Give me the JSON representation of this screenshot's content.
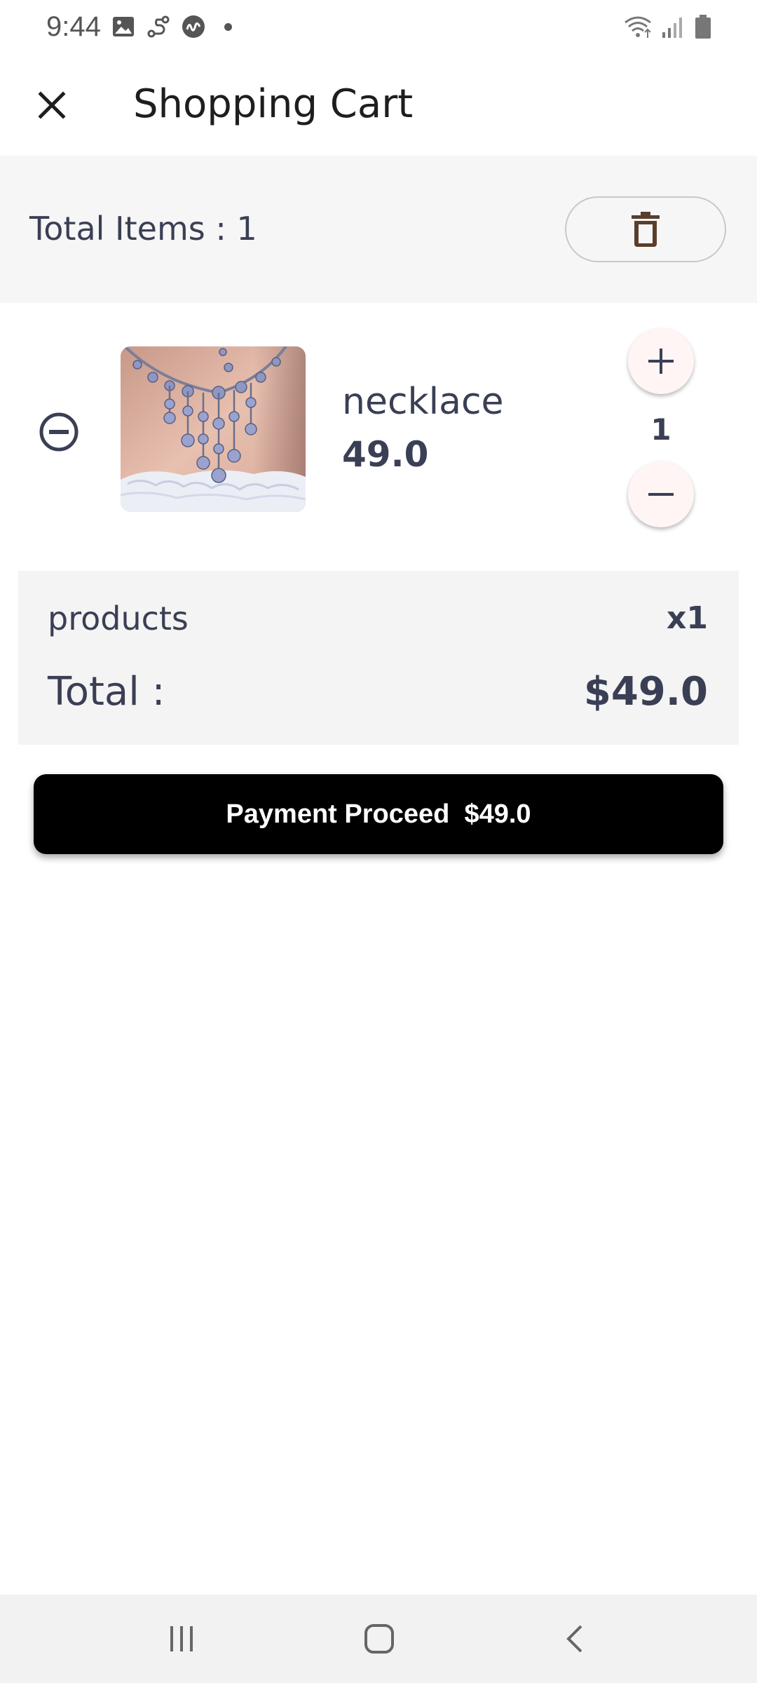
{
  "status_bar": {
    "time": "9:44",
    "left_icons": [
      "image-icon",
      "route-icon",
      "app-icon",
      "dot-icon"
    ],
    "right_icons": [
      "wifi-icon",
      "signal-icon",
      "battery-icon"
    ]
  },
  "app_bar": {
    "title": "Shopping Cart",
    "close_icon": "close-icon"
  },
  "items_header": {
    "total_items_label": "Total Items :  1",
    "delete_icon": "trash-icon"
  },
  "cart_items": [
    {
      "name": "necklace",
      "price": "49.0",
      "quantity": "1",
      "image_icon": "necklace-product-image"
    }
  ],
  "summary": {
    "products_label": "products",
    "products_count": "x1",
    "total_label": "Total :",
    "total_value": "$49.0"
  },
  "payment_button": {
    "label": "Payment Proceed  $49.0"
  },
  "nav_bar": {
    "icons": [
      "recent-apps-icon",
      "home-icon",
      "back-icon"
    ]
  },
  "colors": {
    "text_primary": "#3a3f55",
    "header_bg": "#f6f6f6",
    "summary_bg": "#f4f4f4",
    "button_bg": "#000000",
    "button_text": "#ffffff",
    "trash_icon": "#5a3e2b"
  }
}
